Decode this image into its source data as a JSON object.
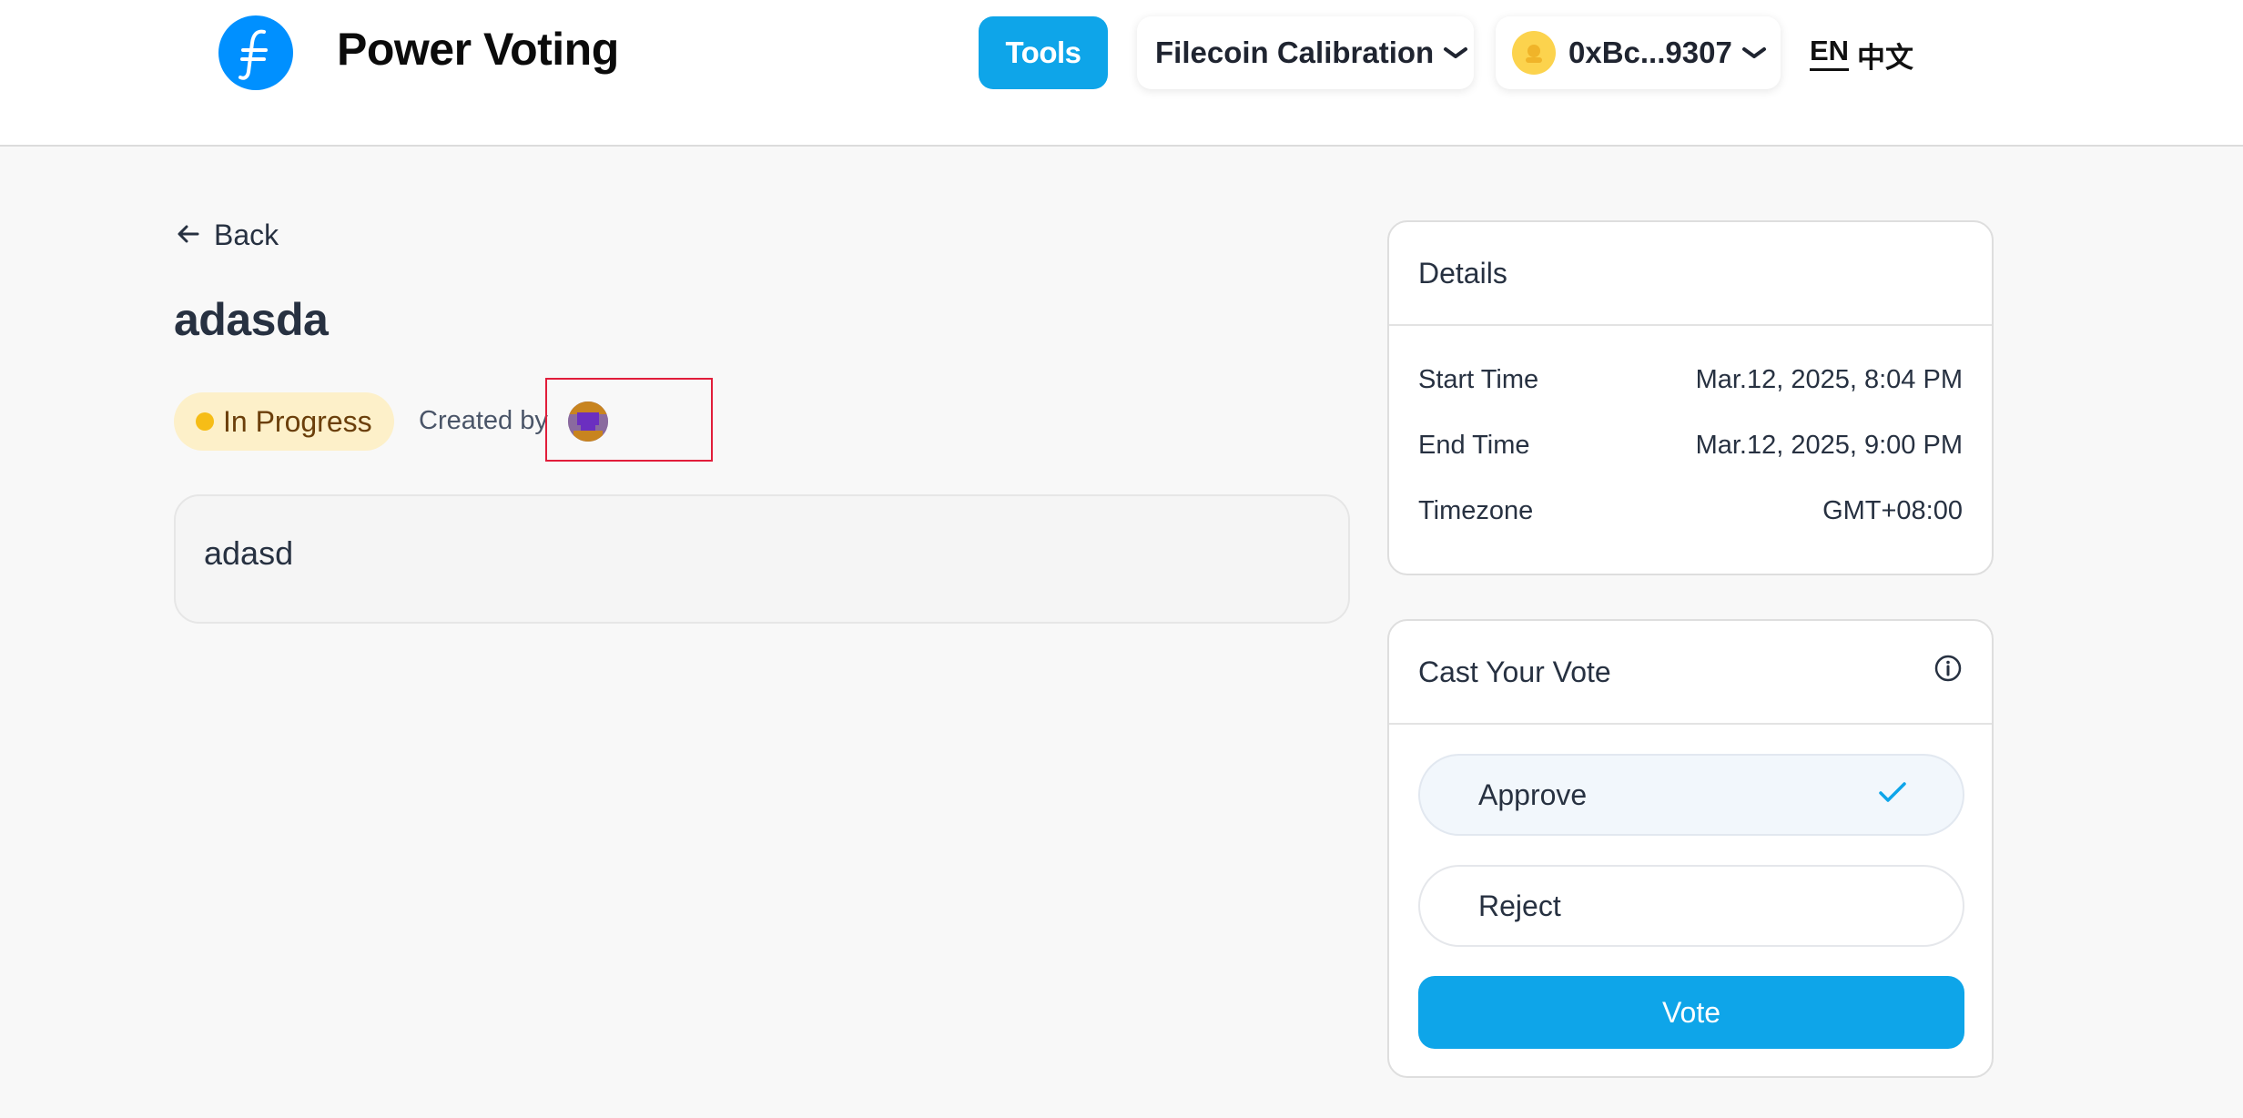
{
  "header": {
    "app_title": "Power Voting",
    "tools_label": "Tools",
    "network_label": "Filecoin Calibration",
    "wallet_address": "0xBc...9307",
    "lang_en": "EN",
    "lang_zh": "中文"
  },
  "back_label": "Back",
  "proposal": {
    "title": "adasda",
    "status": "In Progress",
    "created_by_label": "Created by",
    "description": "adasd"
  },
  "details": {
    "heading": "Details",
    "rows": [
      {
        "label": "Start Time",
        "value": "Mar.12, 2025, 8:04 PM"
      },
      {
        "label": "End Time",
        "value": "Mar.12, 2025, 9:00 PM"
      },
      {
        "label": "Timezone",
        "value": "GMT+08:00"
      }
    ]
  },
  "vote": {
    "heading": "Cast Your Vote",
    "options": [
      {
        "label": "Approve",
        "selected": true
      },
      {
        "label": "Reject",
        "selected": false
      }
    ],
    "button_label": "Vote"
  },
  "colors": {
    "accent": "#0ea5e9",
    "logo_blue": "#0090ff",
    "status_bg": "#fdf0c9",
    "status_dot": "#f6bd16",
    "highlight_border": "#e11d3a"
  },
  "icons": [
    "filecoin-logo-icon",
    "chevron-down-icon",
    "wallet-avatar-icon",
    "arrow-left-icon",
    "info-icon",
    "check-icon",
    "creator-avatar-icon"
  ]
}
